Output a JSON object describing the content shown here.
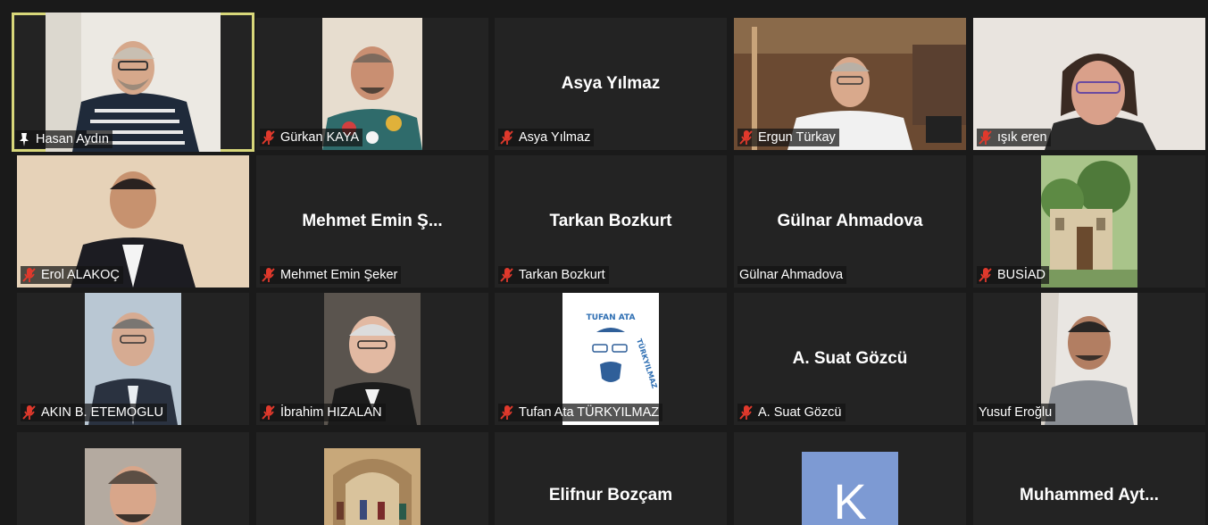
{
  "colors": {
    "background": "#1a1a1a",
    "tile": "#232323",
    "active_border": "#d8d77a",
    "muted_icon": "#e0392c",
    "avatar_k": "#7d9ad3"
  },
  "participants": [
    {
      "label": "Hasan Aydın",
      "muted": false,
      "pinned": true
    },
    {
      "label": "Gürkan KAYA",
      "muted": true
    },
    {
      "label": "Asya Yılmaz",
      "center": "Asya Yılmaz",
      "muted": true
    },
    {
      "label": "Ergun Türkay",
      "muted": true
    },
    {
      "label": "ışık eren",
      "muted": true
    },
    {
      "label": "Erol ALAKOÇ",
      "muted": true
    },
    {
      "label": "Mehmet Emin Şeker",
      "center": "Mehmet  Emin  Ş...",
      "muted": true
    },
    {
      "label": "Tarkan Bozkurt",
      "center": "Tarkan Bozkurt",
      "muted": true
    },
    {
      "label": "Gülnar Ahmadova",
      "center": "Gülnar Ahmadova",
      "muted": false
    },
    {
      "label": "BUSİAD",
      "muted": true
    },
    {
      "label": "AKIN B. ETEMOGLU",
      "muted": true
    },
    {
      "label": "İbrahim HIZALAN",
      "muted": true
    },
    {
      "label": "Tufan Ata TÜRKYILMAZ",
      "muted": true,
      "logo_text": "TUFAN ATA TÜRKYILMAZ"
    },
    {
      "label": "A. Suat Gözcü",
      "center": "A. Suat Gözcü",
      "muted": true
    },
    {
      "label": "Yusuf Eroğlu",
      "muted": false
    },
    {
      "label": "",
      "muted": false
    },
    {
      "label": "",
      "muted": false
    },
    {
      "label": "",
      "center": "Elifnur Bozçam",
      "muted": false
    },
    {
      "label": "",
      "avatar_letter": "K",
      "muted": false
    },
    {
      "label": "",
      "center": "Muhammed  Ayt...",
      "muted": false
    }
  ]
}
